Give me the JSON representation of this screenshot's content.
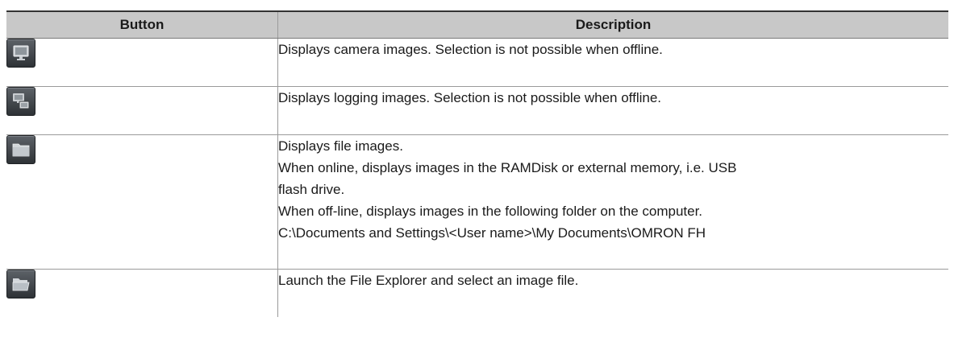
{
  "table": {
    "headers": {
      "button": "Button",
      "description": "Description"
    },
    "rows": [
      {
        "icon": "camera-image-icon",
        "lines": [
          "Displays camera images. Selection is not possible when offline."
        ]
      },
      {
        "icon": "logging-image-icon",
        "lines": [
          "Displays logging images. Selection is not possible when offline."
        ]
      },
      {
        "icon": "file-image-folder-icon",
        "lines": [
          "Displays file images.",
          "When online, displays images in the RAMDisk or external memory, i.e. USB",
          "flash drive.",
          "When off-line, displays images in the following folder on the computer.",
          "C:\\Documents and Settings\\<User name>\\My Documents\\OMRON FH"
        ]
      },
      {
        "icon": "open-folder-icon",
        "lines": [
          "Launch the File Explorer and select an image file."
        ]
      }
    ]
  }
}
